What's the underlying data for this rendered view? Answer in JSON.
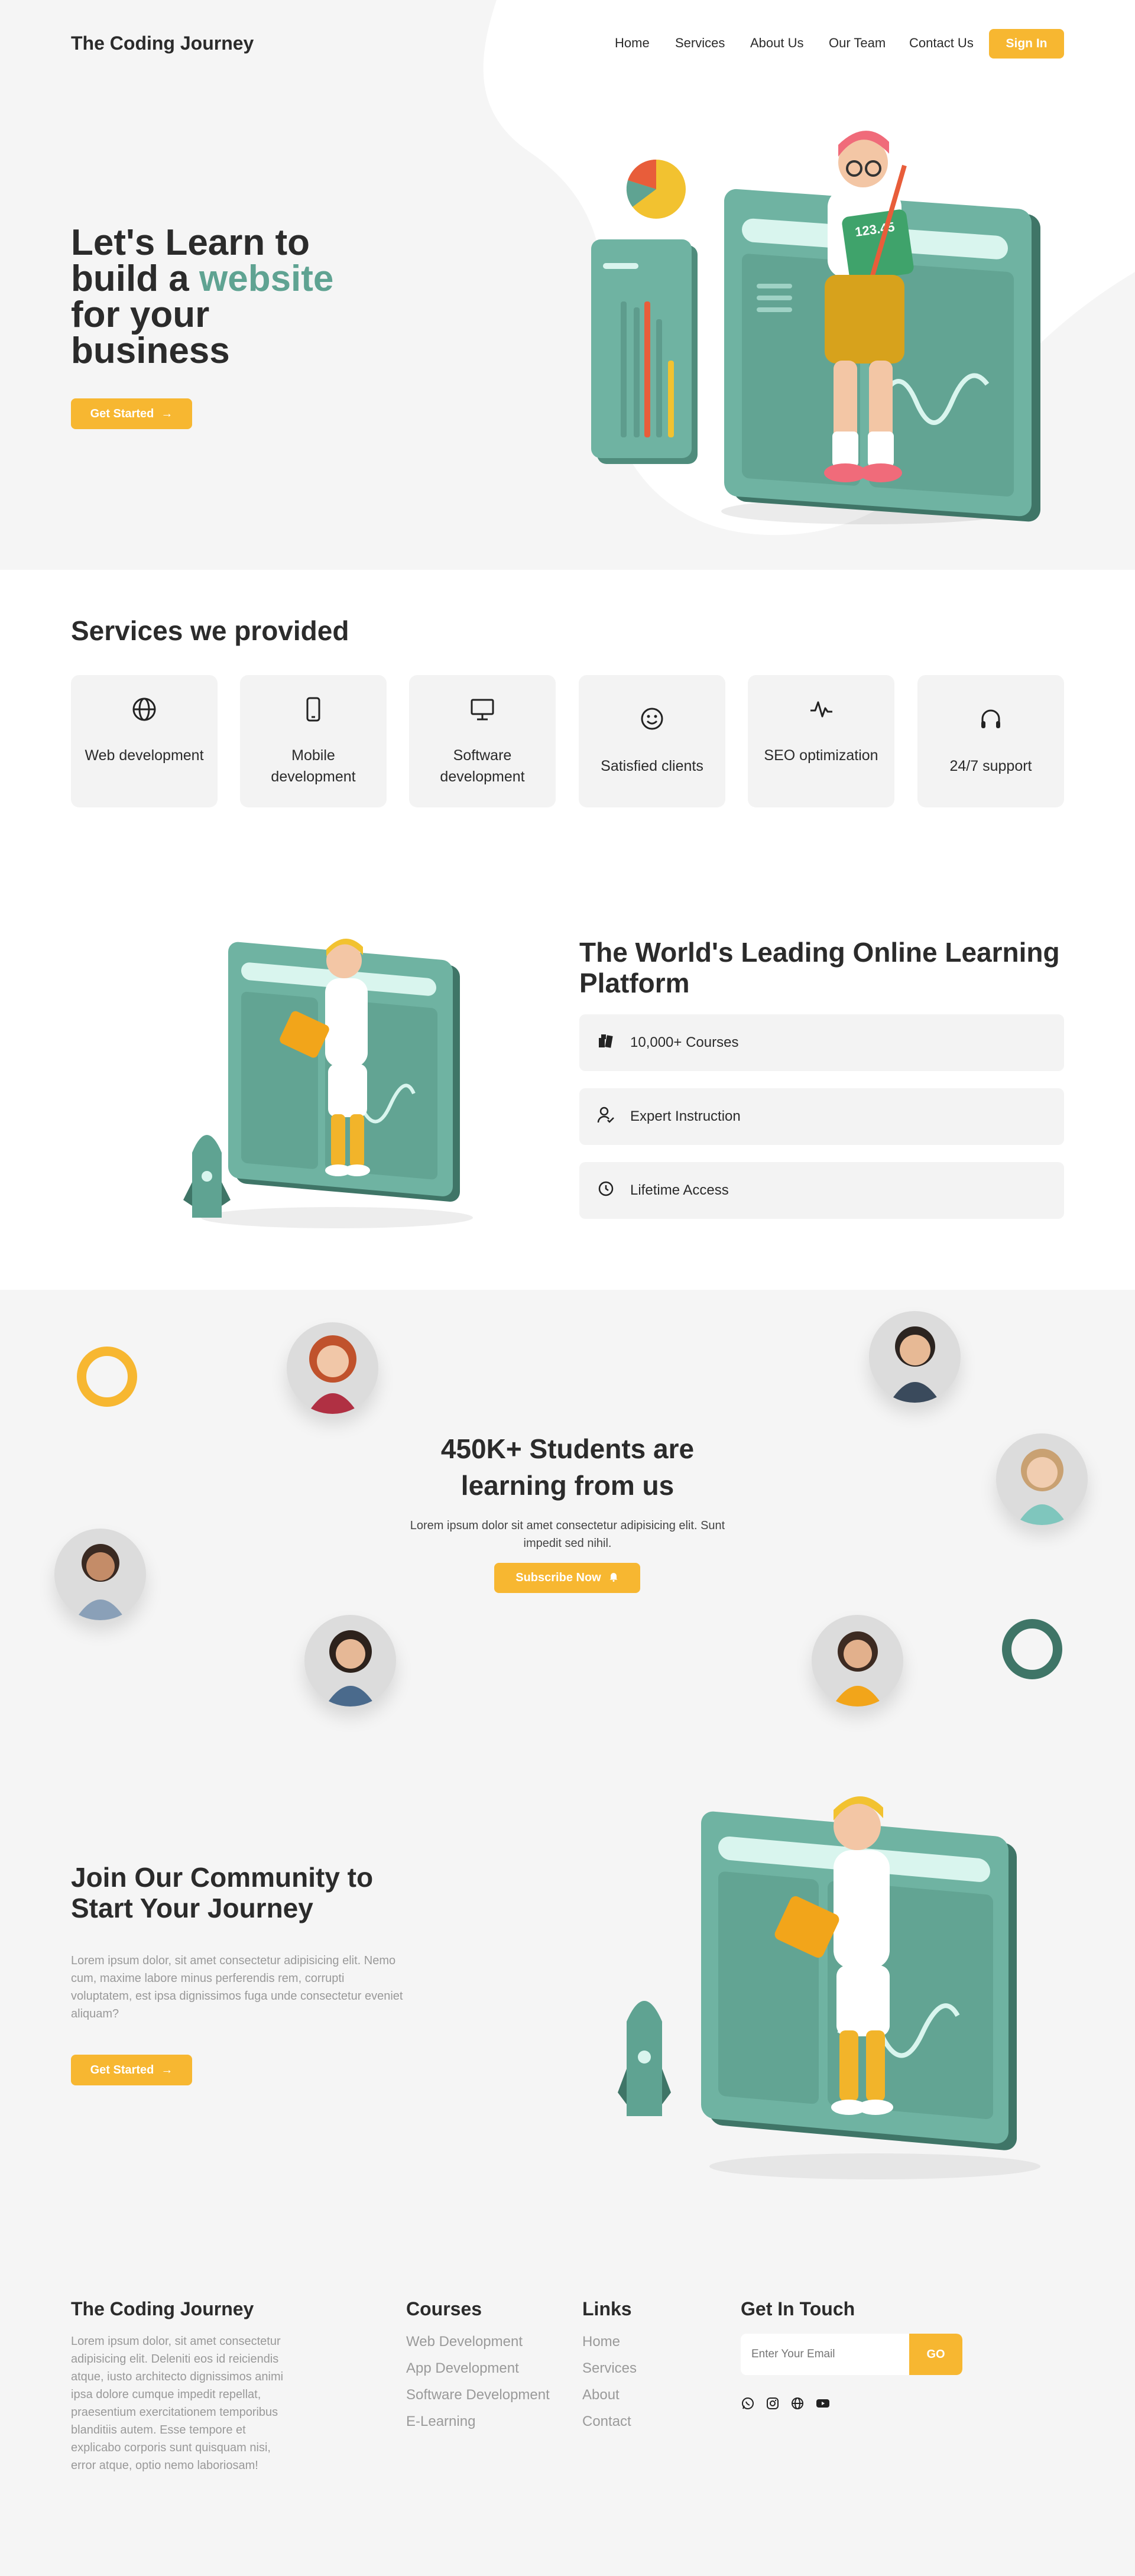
{
  "brand": "The Coding Journey",
  "nav": {
    "items": [
      "Home",
      "Services",
      "About Us",
      "Our Team",
      "Contact Us"
    ],
    "sign_in": "Sign In"
  },
  "hero": {
    "title_line1": "Let's Learn to",
    "title_line2_a": "build a ",
    "title_line2_b": "website",
    "title_line3": "for your",
    "title_line4": "business",
    "cta": "Get Started",
    "chart_label": "123.45"
  },
  "services": {
    "heading": "Services we provided",
    "items": [
      {
        "label": "Web development",
        "icon": "globe-icon"
      },
      {
        "label": "Mobile development",
        "icon": "mobile-icon"
      },
      {
        "label": "Software development",
        "icon": "monitor-icon"
      },
      {
        "label": "Satisfied clients",
        "icon": "smile-icon"
      },
      {
        "label": "SEO optimization",
        "icon": "pulse-icon"
      },
      {
        "label": "24/7 support",
        "icon": "headphones-icon"
      }
    ]
  },
  "platform": {
    "heading": "The World's Leading Online Learning Platform",
    "features": [
      {
        "label": "10,000+ Courses",
        "icon": "books-icon"
      },
      {
        "label": "Expert Instruction",
        "icon": "user-check-icon"
      },
      {
        "label": "Lifetime Access",
        "icon": "clock-icon"
      }
    ]
  },
  "students": {
    "heading": "450K+ Students are learning from us",
    "text": "Lorem ipsum dolor sit amet consectetur adipisicing elit. Sunt impedit sed nihil.",
    "cta": "Subscribe Now"
  },
  "community": {
    "heading": "Join Our Community to Start Your Journey",
    "text": "Lorem ipsum dolor, sit amet consectetur adipisicing elit. Nemo cum, maxime labore minus perferendis rem, corrupti voluptatem, est ipsa dignissimos fuga unde consectetur eveniet aliquam?",
    "cta": "Get Started"
  },
  "footer": {
    "brand": "The Coding Journey",
    "about": "Lorem ipsum dolor, sit amet consectetur adipisicing elit. Deleniti eos id reiciendis atque, iusto architecto dignissimos animi ipsa dolore cumque impedit repellat, praesentium exercitationem temporibus blanditiis autem. Esse tempore et explicabo corporis sunt quisquam nisi, error atque, optio nemo laboriosam!",
    "courses_heading": "Courses",
    "courses": [
      "Web Development",
      "App Development",
      "Software Development",
      "E-Learning"
    ],
    "links_heading": "Links",
    "links": [
      "Home",
      "Services",
      "About",
      "Contact"
    ],
    "contact_heading": "Get In Touch",
    "email_placeholder": "Enter Your Email",
    "go": "GO",
    "social": [
      "whatsapp-icon",
      "instagram-icon",
      "globe-icon",
      "youtube-icon"
    ]
  },
  "colors": {
    "accent": "#f7b731",
    "teal": "#5fa392",
    "dark_teal": "#3f7567",
    "background": "#f5f5f5"
  }
}
